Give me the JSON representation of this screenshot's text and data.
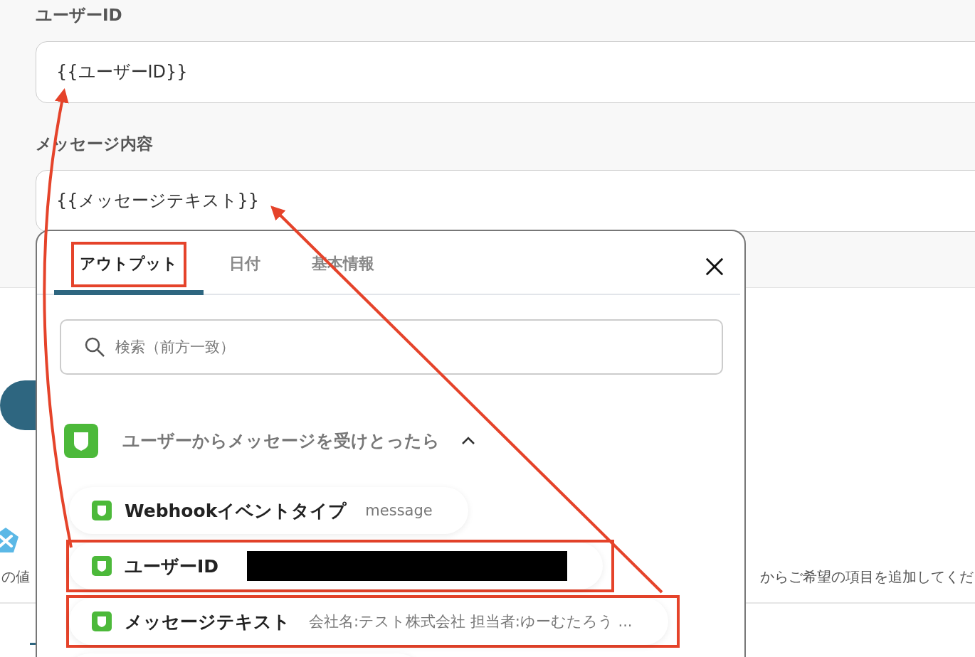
{
  "fields": [
    {
      "label": "ユーザーID",
      "value": "{{ユーザーID}}"
    },
    {
      "label": "メッセージ内容",
      "value": "{{メッセージテキスト}}"
    }
  ],
  "background": {
    "note_left": "の値",
    "note_right": "からご希望の項目を追加してくだ"
  },
  "picker": {
    "tabs": [
      {
        "label": "アウトプット",
        "selected": true,
        "highlighted": true
      },
      {
        "label": "日付",
        "selected": false,
        "highlighted": false
      },
      {
        "label": "基本情報",
        "selected": false,
        "highlighted": false
      }
    ],
    "search": {
      "placeholder": "検索（前方一致）"
    },
    "section": {
      "title": "ユーザーからメッセージを受けとったら",
      "expanded": true
    },
    "items": [
      {
        "name": "Webhookイベントタイプ",
        "value": "message",
        "redacted": false,
        "highlighted": false
      },
      {
        "name": "ユーザーID",
        "redacted": true,
        "highlighted": true
      },
      {
        "name": "メッセージテキスト",
        "value": "会社名:テスト株式会社 担当者:ゆーむたろう ...",
        "redacted": false,
        "highlighted": true
      }
    ]
  }
}
